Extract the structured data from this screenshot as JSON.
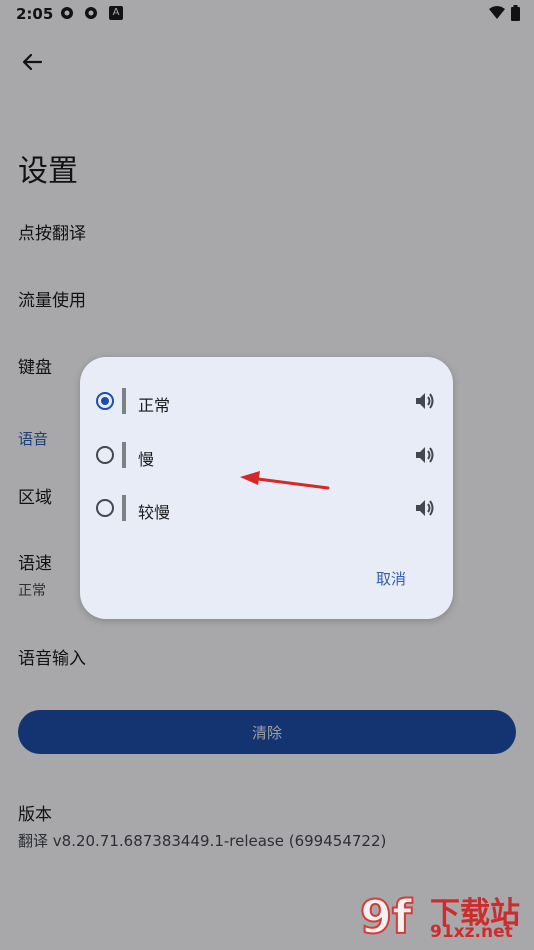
{
  "status": {
    "time": "2:05",
    "notification_badge": "A"
  },
  "header": {
    "title": "设置"
  },
  "settings": {
    "tap_translate": "点按翻译",
    "data_usage": "流量使用",
    "keyboard": "键盘",
    "voice_section": "语音",
    "region": "区域",
    "speech_rate": {
      "label": "语速",
      "value": "正常"
    },
    "voice_input": "语音输入",
    "clear_button": "清除",
    "version": {
      "label": "版本",
      "value": "翻译 v8.20.71.687383449.1-release (699454722)"
    }
  },
  "dialog": {
    "options": [
      {
        "label": "正常",
        "selected": true
      },
      {
        "label": "慢",
        "selected": false
      },
      {
        "label": "较慢",
        "selected": false
      }
    ],
    "cancel_label": "取消"
  },
  "watermark": {
    "logo": "9f",
    "text": "下载站",
    "url": "91xz.net"
  },
  "colors": {
    "accent": "#1d4ea8",
    "arrow": "#d62828"
  }
}
